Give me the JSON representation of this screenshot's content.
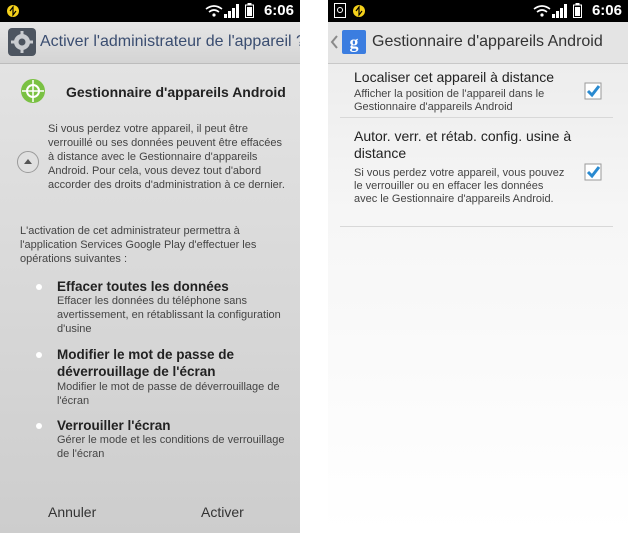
{
  "status_bar": {
    "time": "6:06"
  },
  "left": {
    "title": "Activer l'administrateur de l'appareil ?",
    "app_name": "Gestionnaire d'appareils Android",
    "description": "Si vous perdez votre appareil, il peut être verrouillé ou ses données peuvent être effacées à distance avec le Gestionnaire d'appareils Android. Pour cela, vous devez tout d'abord accorder des droits d'administration à ce dernier.",
    "activation_text": "L'activation de cet administrateur permettra à l'application Services Google Play d'effectuer les opérations suivantes :",
    "permissions": [
      {
        "title": "Effacer toutes les données",
        "description": "Effacer les données du téléphone sans avertissement, en rétablissant la configuration d'usine"
      },
      {
        "title": "Modifier le mot de passe de déverrouillage de l'écran",
        "description": "Modifier le mot de passe de déverrouillage de l'écran"
      },
      {
        "title": "Verrouiller l'écran",
        "description": "Gérer le mode et les conditions de verrouillage de l'écran"
      }
    ],
    "buttons": {
      "cancel": "Annuler",
      "activate": "Activer"
    }
  },
  "right": {
    "title": "Gestionnaire d'appareils Android",
    "google_logo_letter": "g",
    "preferences": [
      {
        "title": "Localiser cet appareil à distance",
        "summary": "Afficher la position de l'appareil dans le Gestionnaire d'appareils Android",
        "checked": true
      },
      {
        "title": "Autor. verr. et rétab. config. usine à distance",
        "summary": "Si vous perdez votre appareil, vous pouvez le verrouiller ou en effacer les données avec le Gestionnaire d'appareils Android.",
        "checked": true
      }
    ]
  },
  "colors": {
    "accent": "#4aa3df",
    "check": "#2a8ad0",
    "google_blue": "#3b7de0",
    "title_text": "#3a4d70"
  }
}
